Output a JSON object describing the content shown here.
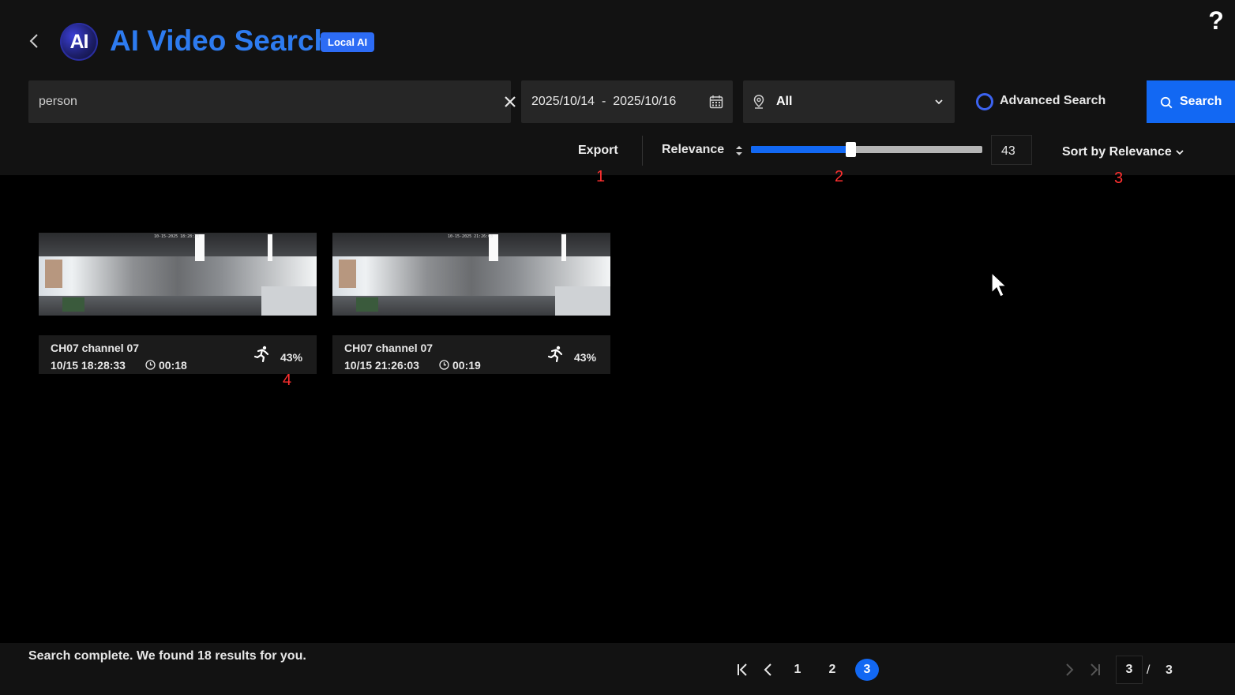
{
  "header": {
    "logo_text": "AI",
    "title": "AI Video Search",
    "badge": "Local AI",
    "help": "?"
  },
  "search": {
    "query": "person",
    "placeholder": "",
    "date_range": "2025/10/14  -  2025/10/16",
    "location": "All",
    "advanced_label": "Advanced Search",
    "search_button": "Search"
  },
  "toolbar": {
    "export_label": "Export",
    "relevance_label": "Relevance",
    "relevance_value": 43,
    "relevance_display": "43",
    "sort_label": "Sort by Relevance"
  },
  "annotations": [
    "1",
    "2",
    "3",
    "4"
  ],
  "results": [
    {
      "channel": "CH07 channel 07",
      "timestamp": "10/15 18:28:33",
      "duration": "00:18",
      "score": "43%",
      "stamp": "10-15-2025 18:28:33"
    },
    {
      "channel": "CH07 channel 07",
      "timestamp": "10/15 21:26:03",
      "duration": "00:19",
      "score": "43%",
      "stamp": "10-15-2025 21:26:03"
    }
  ],
  "footer": {
    "status": "Search complete. We found 18 results for you.",
    "pages": [
      "1",
      "2",
      "3"
    ],
    "current_page": "3",
    "separator": "/",
    "total_pages": "3"
  },
  "colors": {
    "accent": "#1268f3",
    "title": "#2d7bf0",
    "annotation": "#ff3030"
  }
}
